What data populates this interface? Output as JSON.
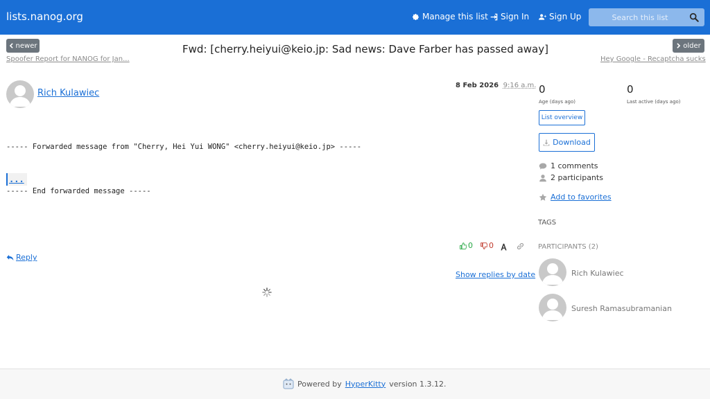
{
  "navbar": {
    "brand": "lists.nanog.org",
    "manage_label": "Manage this list",
    "signin_label": "Sign In",
    "signup_label": "Sign Up",
    "search_placeholder": "Search this list",
    "bg_color": "#1a6fd6"
  },
  "pager": {
    "newer_label": "newer",
    "older_label": "older",
    "newer_link": "Spoofer Report for NANOG for Jan...",
    "older_link": "Hey Google - Recaptcha sucks"
  },
  "thread": {
    "title": "Fwd: [cherry.heiyui@keio.jp: Sad news: Dave Farber has passed away]"
  },
  "message": {
    "author": "Rich Kulawiec",
    "date": "8 Feb 2026",
    "time": "9:16 a.m.",
    "forward_start": "----- Forwarded message from \"Cherry, Hei Yui WONG\" <cherry.heiyui@keio.jp> -----",
    "ellipsis": "...",
    "forward_end": "----- End forwarded message -----",
    "likes": "0",
    "dislikes": "0",
    "reply_label": "Reply",
    "show_replies_label": "Show replies by date"
  },
  "sidebar": {
    "age_value": "0",
    "age_label": "Age (days ago)",
    "last_active_value": "0",
    "last_active_label": "Last active (days ago)",
    "list_overview_label": "List overview",
    "download_label": "Download",
    "comments": "1 comments",
    "participants_count": "2 participants",
    "favorites_label": "Add to favorites",
    "tags_heading": "TAGS",
    "participants_heading": "PARTICIPANTS (2)",
    "participants": [
      {
        "name": "Rich Kulawiec"
      },
      {
        "name": "Suresh Ramasubramanian"
      }
    ]
  },
  "footer": {
    "powered_by": "Powered by",
    "hyperkitty": "HyperKitty",
    "version": "version 1.3.12."
  }
}
